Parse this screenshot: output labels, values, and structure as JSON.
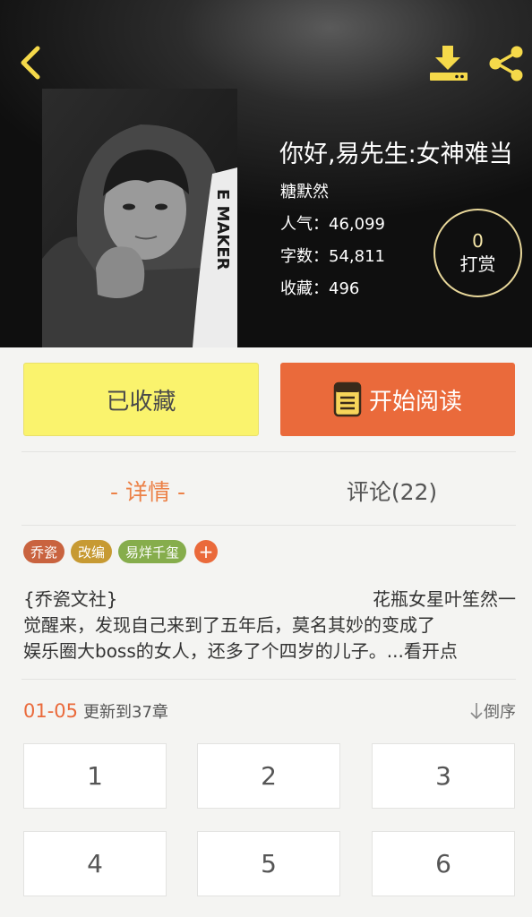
{
  "book": {
    "title": "你好,易先生:女神难当",
    "author": "糖默然",
    "stats": {
      "popularity": "人气：46,099",
      "words": "字数：54,811",
      "favorites": "收藏：496"
    },
    "tip": {
      "count": "0",
      "label": "打赏"
    }
  },
  "actions": {
    "collected_label": "已收藏",
    "read_label": "开始阅读"
  },
  "tabs": {
    "detail": "- 详情 -",
    "comments": "评论(22)"
  },
  "tags": [
    {
      "label": "乔瓷",
      "color": "#c9633f"
    },
    {
      "label": "改编",
      "color": "#c79a33"
    },
    {
      "label": "易烊千玺",
      "color": "#86ad4c"
    }
  ],
  "tag_add": "+",
  "synopsis": {
    "line1_left": "{乔瓷文社}",
    "line1_right": "花瓶女星叶笙然一",
    "line2": "觉醒来，发现自己来到了五年后，莫名其妙的变成了",
    "line3": "娱乐圈大boss的女人，还多了个四岁的儿子。...看开点"
  },
  "chapters": {
    "date": "01-05",
    "update_text": "更新到37章",
    "sort_label": "倒序",
    "items": [
      "1",
      "2",
      "3",
      "4",
      "5",
      "6"
    ]
  },
  "colors": {
    "accent": "#ea6a3b",
    "collected_bg": "#faf36d",
    "icon_yellow": "#f5d94a"
  },
  "icons": [
    "back-arrow-icon",
    "download-icon",
    "share-icon",
    "book-icon",
    "sort-down-arrow-icon",
    "add-icon"
  ]
}
